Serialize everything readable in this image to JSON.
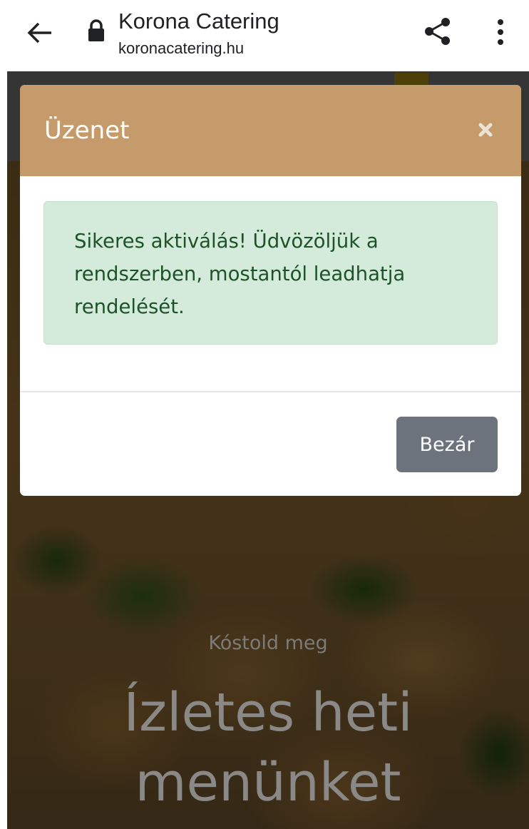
{
  "browser": {
    "title": "Korona Catering",
    "url": "koronacatering.hu",
    "icons": [
      "back-arrow-icon",
      "lock-icon",
      "share-icon",
      "more-vert-icon"
    ]
  },
  "page": {
    "hero_subtitle": "Kóstold meg",
    "hero_title_line1": "Ízletes heti",
    "hero_title_line2": "menünket"
  },
  "modal": {
    "title": "Üzenet",
    "close_icon": "close-x-icon",
    "alert_message": "Sikeres aktiválás! Üdvözöljük a rendszerben, mostantól leadhatja rendelését.",
    "close_button_label": "Bezár"
  },
  "colors": {
    "modal_header": "#c59b6c",
    "alert_background": "#d4eadb",
    "alert_text": "#1c5428",
    "close_button": "#6c737d"
  }
}
